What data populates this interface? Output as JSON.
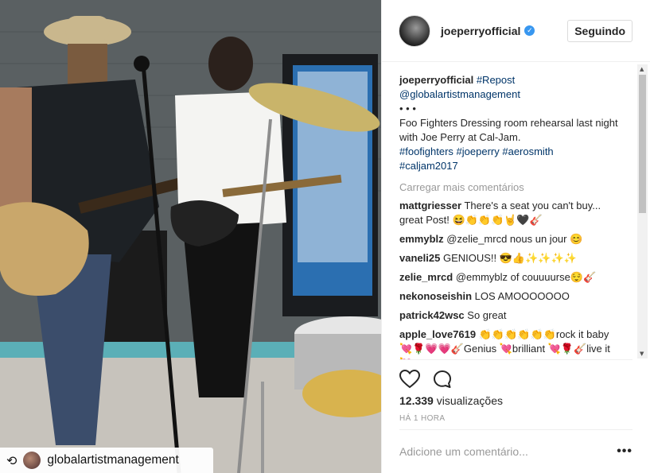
{
  "post": {
    "username": "joeperryofficial",
    "follow_label": "Seguindo",
    "caption": {
      "user": "joeperryofficial",
      "repost_tag": "#Repost",
      "mention": "@globalartistmanagement",
      "dots": "• • •",
      "text": "Foo Fighters Dressing room rehearsal last night with Joe Perry at Cal-Jam.",
      "hashtags": "#foofighters #joeperry #aerosmith",
      "hashtag2": "#caljam2017"
    },
    "load_more": "Carregar mais comentários",
    "comments": [
      {
        "user": "mattgriesser",
        "text": "There's a seat you can't buy... great Post! 😆👏👏👏🤘🖤🎸"
      },
      {
        "user": "emmyblz",
        "text": "@zelie_mrcd nous un jour 😊"
      },
      {
        "user": "vaneli25",
        "text": "GENIOUS!! 😎👍✨✨✨✨"
      },
      {
        "user": "zelie_mrcd",
        "text": "@emmyblz of couuuurse😌🎸"
      },
      {
        "user": "nekonoseishin",
        "text": "LOS AMOOOOOOO"
      },
      {
        "user": "patrick42wsc",
        "text": "So great"
      },
      {
        "user": "apple_love7619",
        "text": "👏👏👏👏👏👏rock it baby 💘🌹💗💗🎸Genius 💘brilliant 💘🌹🎸live it💘"
      }
    ],
    "views_count": "12.339",
    "views_label": "visualizações",
    "time": "HÁ 1 HORA",
    "add_comment_placeholder": "Adicione um comentário...",
    "more_label": "•••",
    "repost_user": "globalartistmanagement",
    "colors": {
      "verified": "#3897f0",
      "link": "#003569",
      "muted": "#999999"
    }
  }
}
